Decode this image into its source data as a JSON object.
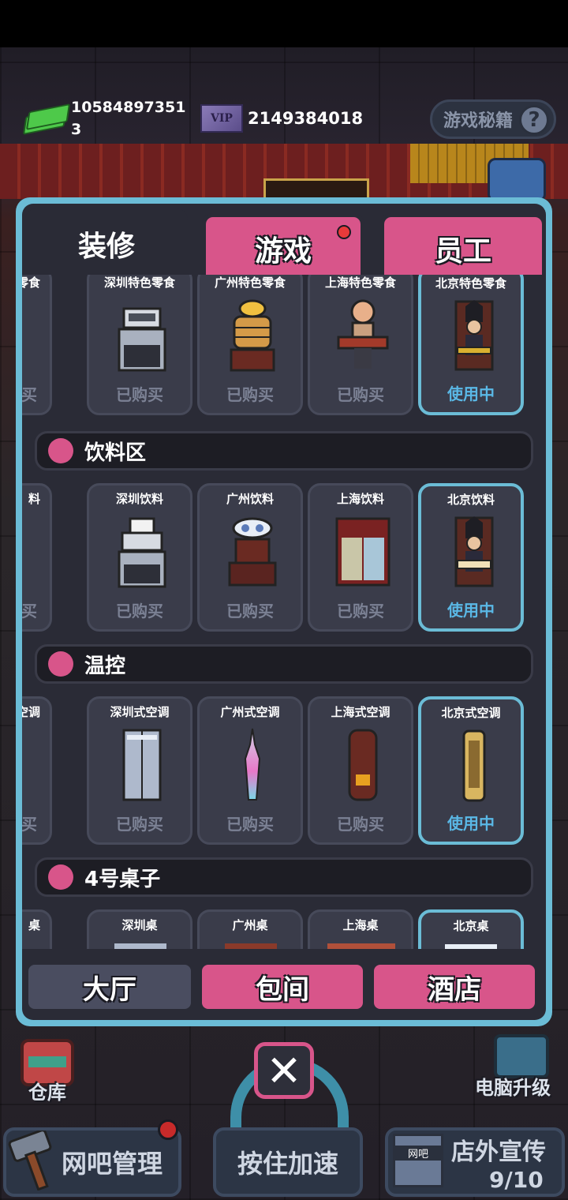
{
  "hud": {
    "money": "10584897351\n3",
    "money_line1": "10584897351",
    "money_line2": "3",
    "vip_badge": "VIP",
    "vip_value": "2149384018",
    "secret_label": "游戏秘籍",
    "help_icon": "?"
  },
  "tabs": [
    {
      "label": "装修",
      "active": true
    },
    {
      "label": "游戏",
      "active": false,
      "notification": true
    },
    {
      "label": "员工",
      "active": false
    }
  ],
  "sections": [
    {
      "title": "",
      "items": [
        {
          "name": "零食",
          "status": "买"
        },
        {
          "name": "深圳特色零食",
          "status": "已购买"
        },
        {
          "name": "广州特色零食",
          "status": "已购买"
        },
        {
          "name": "上海特色零食",
          "status": "已购买"
        },
        {
          "name": "北京特色零食",
          "status": "使用中"
        }
      ]
    },
    {
      "title": "饮料区",
      "items": [
        {
          "name": "料",
          "status": "买"
        },
        {
          "name": "深圳饮料",
          "status": "已购买"
        },
        {
          "name": "广州饮料",
          "status": "已购买"
        },
        {
          "name": "上海饮料",
          "status": "已购买"
        },
        {
          "name": "北京饮料",
          "status": "使用中"
        }
      ]
    },
    {
      "title": "温控",
      "items": [
        {
          "name": "空调",
          "status": "买"
        },
        {
          "name": "深圳式空调",
          "status": "已购买"
        },
        {
          "name": "广州式空调",
          "status": "已购买"
        },
        {
          "name": "上海式空调",
          "status": "已购买"
        },
        {
          "name": "北京式空调",
          "status": "使用中"
        }
      ]
    },
    {
      "title": "4号桌子",
      "items": [
        {
          "name": "桌",
          "status": ""
        },
        {
          "name": "深圳桌",
          "status": ""
        },
        {
          "name": "广州桌",
          "status": ""
        },
        {
          "name": "上海桌",
          "status": ""
        },
        {
          "name": "北京桌",
          "status": ""
        }
      ]
    }
  ],
  "floors": [
    {
      "label": "大厅",
      "active": true
    },
    {
      "label": "包间",
      "active": false
    },
    {
      "label": "酒店",
      "active": false
    }
  ],
  "bottom": {
    "warehouse": "仓库",
    "pc_upgrade": "电脑升级",
    "manage": "网吧管理",
    "speed": "按住加速",
    "promo": "店外宣传",
    "promo_count": "9/10",
    "close_icon": "✕",
    "shop_sign": "网吧"
  },
  "colors": {
    "accent_pink": "#d8558a",
    "accent_blue": "#6bbcd6",
    "in_use": "#5ab8e6",
    "purchased": "#7b8194"
  }
}
